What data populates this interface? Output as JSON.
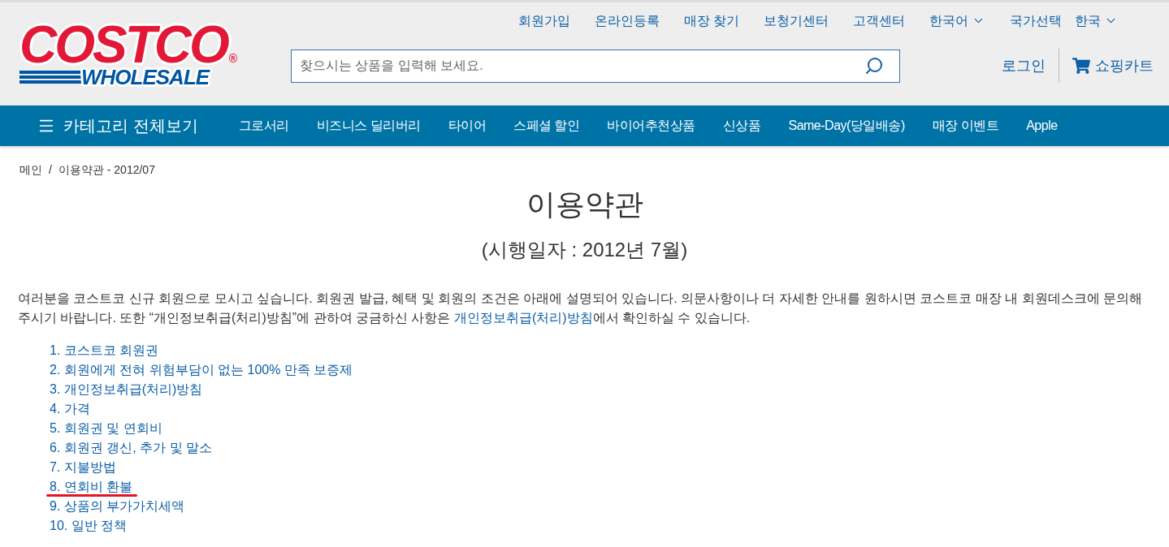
{
  "header": {
    "logo": {
      "wordmark": "COSTCO",
      "registered": "®",
      "tagline": "WHOLESALE"
    },
    "top_links": [
      {
        "label": "회원가입",
        "kind": "link"
      },
      {
        "label": "온라인등록",
        "kind": "link"
      },
      {
        "label": "매장 찾기",
        "kind": "link"
      },
      {
        "label": "보청기센터",
        "kind": "link"
      },
      {
        "label": "고객센터",
        "kind": "link"
      },
      {
        "label": "한국어",
        "kind": "dropdown"
      },
      {
        "label": "국가선택",
        "kind": "label"
      },
      {
        "label": "한국",
        "kind": "dropdown"
      }
    ],
    "search": {
      "placeholder": "찾으시는 상품을 입력해 보세요."
    },
    "login": "로그인",
    "cart": "쇼핑카트"
  },
  "nav": {
    "category_menu": "카테고리 전체보기",
    "items": [
      "그로서리",
      "비즈니스 딜리버리",
      "타이어",
      "스페셜 할인",
      "바이어추천상품",
      "신상품",
      "Same-Day(당일배송)",
      "매장 이벤트",
      "Apple"
    ]
  },
  "breadcrumb": {
    "items": [
      "메인",
      "이용약관 - 2012/07"
    ],
    "separator": "/"
  },
  "title": "이용약관",
  "subtitle": "(시행일자 : 2012년 7월)",
  "intro": {
    "before": "여러분을 코스트코 신규 회원으로 모시고 싶습니다. 회원권 발급, 혜택 및 회원의 조건은 아래에 설명되어 있습니다. 의문사항이나 더 자세한 안내를 원하시면 코스트코 매장 내 회원데스크에 문의해 주시기 바랍니다. 또한 “개인정보취급(처리)방침”에 관하여 궁금하신 사항은 ",
    "link": "개인정보취급(처리)방침",
    "after": "에서 확인하실 수 있습니다."
  },
  "contents": [
    {
      "label": "1. 코스트코 회원권",
      "underlined": false
    },
    {
      "label": "2. 회원에게 전혀 위험부담이 없는 100% 만족 보증제",
      "underlined": false
    },
    {
      "label": "3. 개인정보취급(처리)방침",
      "underlined": false
    },
    {
      "label": "4. 가격",
      "underlined": false
    },
    {
      "label": "5. 회원권 및 연회비",
      "underlined": false
    },
    {
      "label": "6. 회원권 갱신, 추가 및 말소",
      "underlined": false
    },
    {
      "label": "7. 지불방법",
      "underlined": false
    },
    {
      "label": "8. 연회비 환불",
      "underlined": true
    },
    {
      "label": "9. 상품의 부가가치세액",
      "underlined": false
    },
    {
      "label": "10. 일반 정책",
      "underlined": false
    }
  ]
}
